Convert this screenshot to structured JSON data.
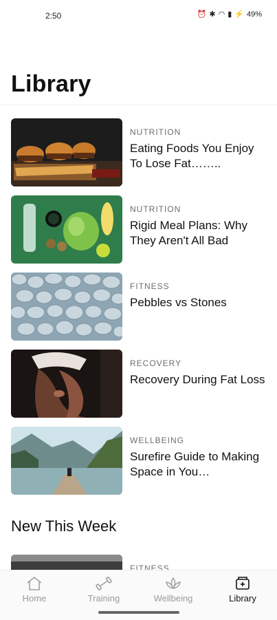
{
  "status": {
    "time": "2:50",
    "battery": "49%"
  },
  "page": {
    "title": "Library"
  },
  "articles": [
    {
      "category": "NUTRITION",
      "title": "Eating Foods You Enjoy To Lose Fat……..",
      "image": "burgers-and-fries-photo"
    },
    {
      "category": "NUTRITION",
      "title": "Rigid Meal Plans: Why They Aren't All Bad",
      "image": "healthy-food-flatlay-photo"
    },
    {
      "category": "FITNESS",
      "title": "Pebbles vs Stones",
      "image": "pebbles-photo"
    },
    {
      "category": "RECOVERY",
      "title": "Recovery During Fat Loss",
      "image": "stretching-person-photo"
    },
    {
      "category": "WELLBEING",
      "title": "Surefire Guide to Making Space in You…",
      "image": "mountain-lake-photo"
    }
  ],
  "new_this_week": {
    "title": "New This Week",
    "items": [
      {
        "category": "FITNESS"
      }
    ]
  },
  "nav": {
    "items": [
      {
        "label": "Home",
        "icon": "home-icon",
        "active": false
      },
      {
        "label": "Training",
        "icon": "dumbbell-icon",
        "active": false
      },
      {
        "label": "Wellbeing",
        "icon": "lotus-icon",
        "active": false
      },
      {
        "label": "Library",
        "icon": "library-icon",
        "active": true
      }
    ]
  }
}
